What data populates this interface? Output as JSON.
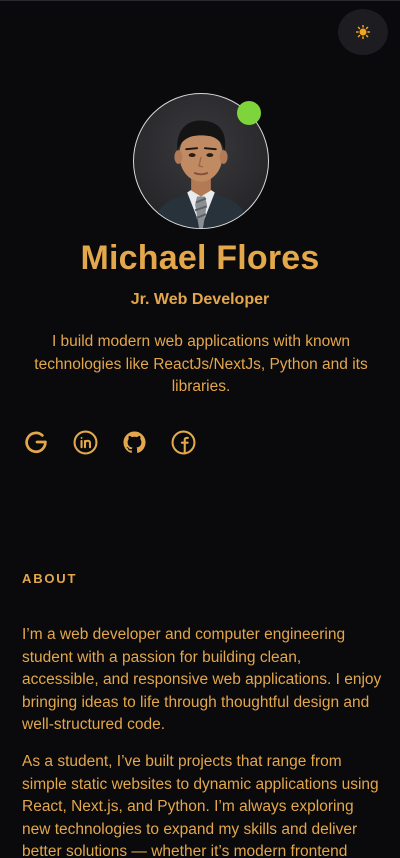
{
  "profile": {
    "name": "Michael Flores",
    "role": "Jr. Web Developer",
    "bio": "I build modern web applications with known technologies like ReactJs/NextJs, Python and its libraries.",
    "status": "online"
  },
  "socials": [
    {
      "icon": "google-icon"
    },
    {
      "icon": "linkedin-icon"
    },
    {
      "icon": "github-icon"
    },
    {
      "icon": "facebook-icon"
    }
  ],
  "about": {
    "heading": "ABOUT",
    "paragraphs": [
      "I’m a web developer and computer engineering student with a passion for building clean, accessible, and responsive web applications. I enjoy bringing ideas to life through thoughtful design and well-structured code.",
      "As a student, I’ve built projects that range from simple static websites to dynamic applications using React, Next.js, and Python. I’m always exploring new technologies to expand my skills and deliver better solutions — whether it’s modern frontend"
    ]
  },
  "colors": {
    "background": "#0a090c",
    "accent": "#e3a74c",
    "status_online": "#7ed53b",
    "toggle_bg": "#1c1c21"
  }
}
